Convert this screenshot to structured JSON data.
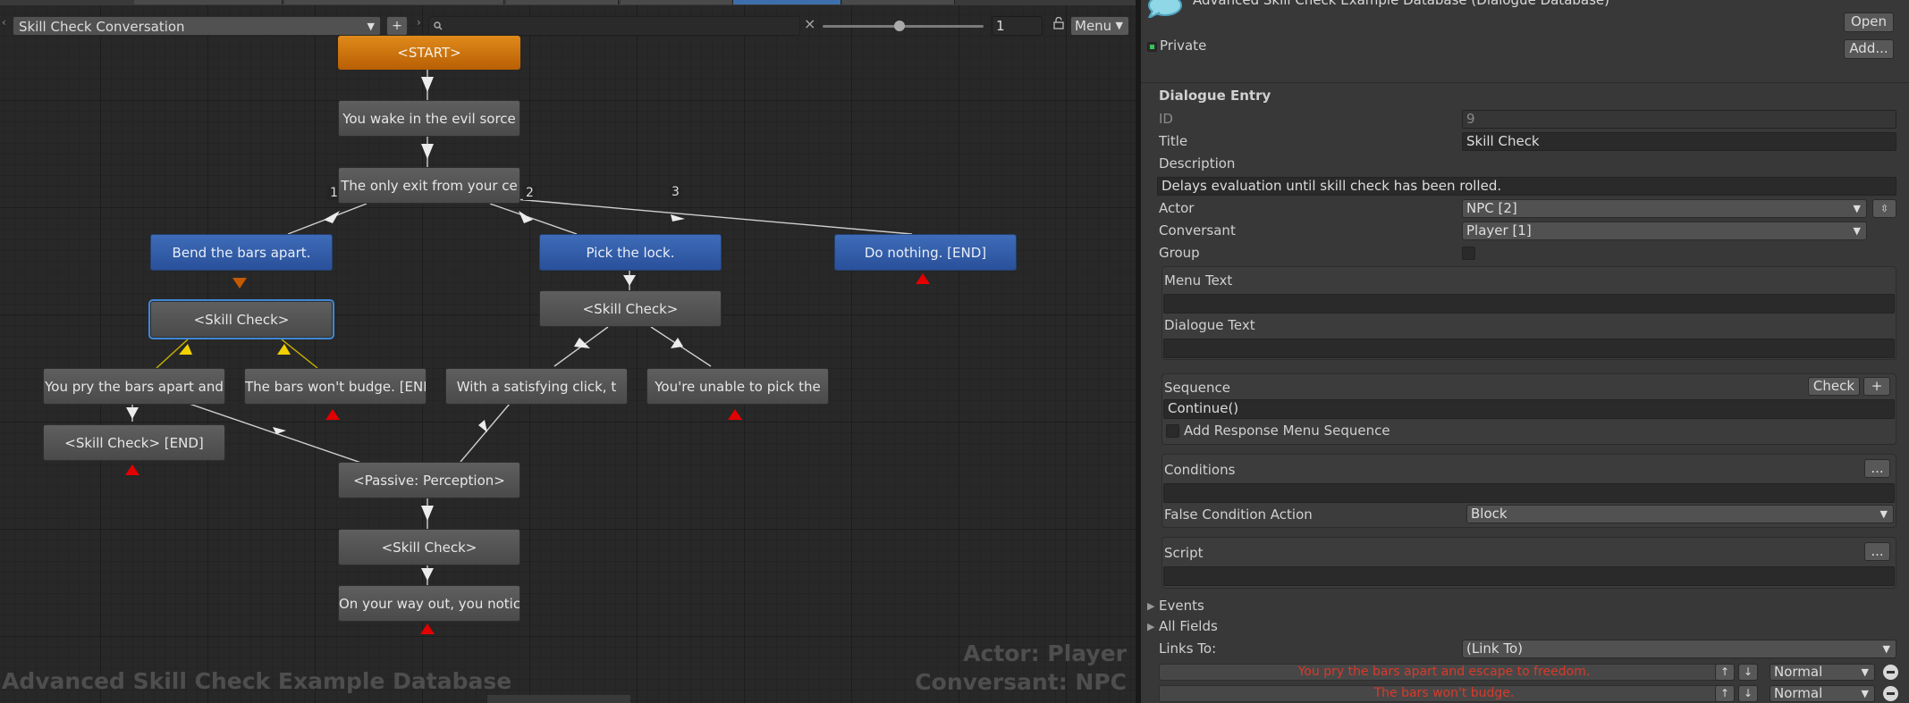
{
  "toolbar": {
    "conversation": "Skill Check Conversation",
    "add_label": "+",
    "clear_label": "×",
    "zoom_value": "1",
    "menu_label": "Menu"
  },
  "graph": {
    "nodes": {
      "start": "<START>",
      "wake": "You wake in the evil sorce",
      "exit": "The only exit from your ce",
      "bend": "Bend the bars apart.",
      "pick": "Pick the lock.",
      "nothing": "Do nothing. [END]",
      "skill1": "<Skill Check>",
      "skill2": "<Skill Check>",
      "pry": "You pry the bars apart and",
      "budge": "The bars won't budge. [END",
      "click": "With a satisfying click, t",
      "unable": "You're unable to pick the",
      "skillend": "<Skill Check> [END]",
      "passive": "<Passive: Perception>",
      "skill3": "<Skill Check>",
      "wayout": "On your way out, you notic"
    },
    "link_numbers": [
      "1",
      "2",
      "3"
    ],
    "watermark": "Advanced Skill Check Example Database",
    "actor_label": "Actor: Player",
    "conversant_label": "Conversant: NPC"
  },
  "inspector": {
    "header_title": "Advanced Skill Check Example Database (Dialogue Database)",
    "open_label": "Open",
    "add_label": "Add...",
    "private_label": "Private",
    "section_title": "Dialogue Entry",
    "id_label": "ID",
    "id_value": "9",
    "title_label": "Title",
    "title_value": "Skill Check",
    "description_label": "Description",
    "description_value": "Delays evaluation until skill check has been rolled.",
    "actor_label": "Actor",
    "actor_value": "NPC [2]",
    "conversant_label": "Conversant",
    "conversant_value": "Player [1]",
    "group_label": "Group",
    "menu_text_label": "Menu Text",
    "dialogue_text_label": "Dialogue Text",
    "sequence_label": "Sequence",
    "check_label": "Check",
    "plus_label": "+",
    "sequence_value": "Continue()",
    "add_response_label": "Add Response Menu Sequence",
    "conditions_label": "Conditions",
    "ellipsis_label": "...",
    "false_condition_label": "False Condition Action",
    "false_condition_value": "Block",
    "script_label": "Script",
    "events_label": "Events",
    "all_fields_label": "All Fields",
    "links_to_label": "Links To:",
    "links_to_value": "(Link To)",
    "links": [
      {
        "text": "You pry the bars apart and escape to freedom.",
        "priority": "Normal"
      },
      {
        "text": "The bars won't budge.",
        "priority": "Normal"
      }
    ]
  }
}
